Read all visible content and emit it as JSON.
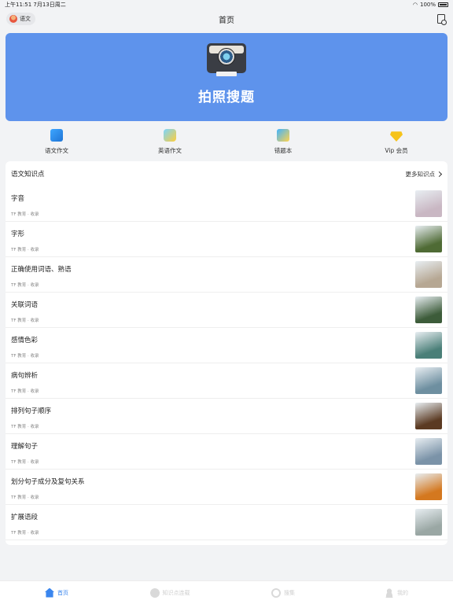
{
  "status": {
    "time": "上午11:51",
    "date": "7月13日周二",
    "battery": "100%"
  },
  "nav": {
    "title": "首页",
    "subject": "语文"
  },
  "banner": {
    "label": "拍照搜题"
  },
  "quick": [
    {
      "label": "语文作文",
      "icon": "essay-icon"
    },
    {
      "label": "英语作文",
      "icon": "english-essay-icon"
    },
    {
      "label": "错题本",
      "icon": "mistake-book-icon"
    },
    {
      "label": "Vip 会员",
      "icon": "vip-diamond-icon"
    }
  ],
  "section": {
    "title": "语文知识点",
    "more": "更多知识点"
  },
  "items": [
    {
      "title": "字音",
      "meta": "TF 教育 · 收录",
      "thumb": "#c9b7c3"
    },
    {
      "title": "字形",
      "meta": "TF 教育 · 收录",
      "thumb": "#4f6b35"
    },
    {
      "title": "正确使用词语、熟语",
      "meta": "TF 教育 · 收录",
      "thumb": "#b6a793"
    },
    {
      "title": "关联词语",
      "meta": "TF 教育 · 收录",
      "thumb": "#3d5c3a"
    },
    {
      "title": "感情色彩",
      "meta": "TF 教育 · 收录",
      "thumb": "#4a7f78"
    },
    {
      "title": "病句辨析",
      "meta": "TF 教育 · 收录",
      "thumb": "#6e8fa0"
    },
    {
      "title": "排列句子顺序",
      "meta": "TF 教育 · 收录",
      "thumb": "#5b3a22"
    },
    {
      "title": "理解句子",
      "meta": "TF 教育 · 收录",
      "thumb": "#7b93a8"
    },
    {
      "title": "划分句子成分及复句关系",
      "meta": "TF 教育 · 收录",
      "thumb": "#d4781f"
    },
    {
      "title": "扩展语段",
      "meta": "TF 教育 · 收录",
      "thumb": "#9aa7a4"
    }
  ],
  "tabs": [
    {
      "label": "首页",
      "active": true
    },
    {
      "label": "知识点连载",
      "active": false
    },
    {
      "label": "搜集",
      "active": false
    },
    {
      "label": "我的",
      "active": false
    }
  ]
}
